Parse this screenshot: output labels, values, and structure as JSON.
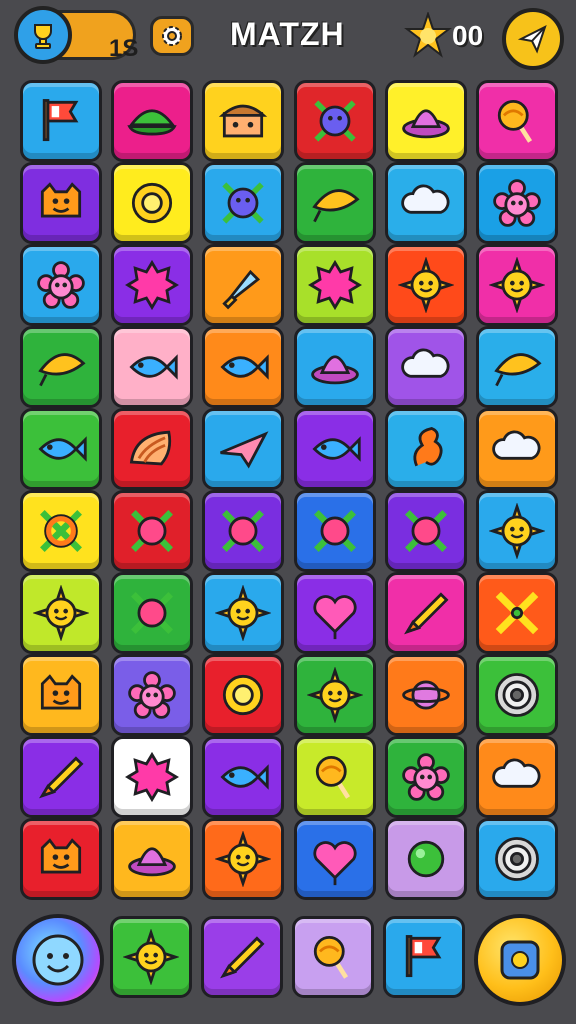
{
  "header": {
    "coin_count": "1S",
    "title": "MATZH",
    "star_count": "00",
    "icons": {
      "coin": "trophy-icon",
      "settings": "gear-icon",
      "star": "sun-star-icon",
      "send": "paper-plane-icon"
    }
  },
  "board": {
    "rows": [
      [
        {
          "color": "#2aa9ec",
          "icon": "flag"
        },
        {
          "color": "#ec1f8b",
          "icon": "cap"
        },
        {
          "color": "#ffd21e",
          "icon": "face"
        },
        {
          "color": "#e0262a",
          "icon": "blob-x"
        },
        {
          "color": "#fff02a",
          "icon": "hat"
        },
        {
          "color": "#f02fa8",
          "icon": "lollipop"
        }
      ],
      [
        {
          "color": "#7f2ee0",
          "icon": "monster"
        },
        {
          "color": "#ffec1e",
          "icon": "ring"
        },
        {
          "color": "#2aa9ec",
          "icon": "blob-x"
        },
        {
          "color": "#2fb33c",
          "icon": "leaf"
        },
        {
          "color": "#2aaeea",
          "icon": "cloud"
        },
        {
          "color": "#1aa0e6",
          "icon": "flower"
        }
      ],
      [
        {
          "color": "#2aa9ec",
          "icon": "flower"
        },
        {
          "color": "#8a2ee6",
          "icon": "splat"
        },
        {
          "color": "#ff9a1a",
          "icon": "rocket"
        },
        {
          "color": "#a8e02a",
          "icon": "splat"
        },
        {
          "color": "#ff4a1a",
          "icon": "sun"
        },
        {
          "color": "#f02fa8",
          "icon": "sun"
        }
      ],
      [
        {
          "color": "#2fb33c",
          "icon": "leaf"
        },
        {
          "color": "#ffb0c8",
          "icon": "fish"
        },
        {
          "color": "#ff8a1a",
          "icon": "fish"
        },
        {
          "color": "#2aa9ec",
          "icon": "hat"
        },
        {
          "color": "#a054e8",
          "icon": "cloud"
        },
        {
          "color": "#2aaeea",
          "icon": "leaf"
        }
      ],
      [
        {
          "color": "#3cc03a",
          "icon": "fish"
        },
        {
          "color": "#e8202c",
          "icon": "shell"
        },
        {
          "color": "#2aa9ec",
          "icon": "plane"
        },
        {
          "color": "#8a2ee6",
          "icon": "fish"
        },
        {
          "color": "#2aaeea",
          "icon": "seahorse"
        },
        {
          "color": "#ff9a1a",
          "icon": "cloud"
        }
      ],
      [
        {
          "color": "#ffe21e",
          "icon": "ring-x"
        },
        {
          "color": "#e0202a",
          "icon": "ball-x"
        },
        {
          "color": "#7a2ee0",
          "icon": "ball-x"
        },
        {
          "color": "#2a70e8",
          "icon": "ball-x"
        },
        {
          "color": "#7a2ee0",
          "icon": "ball-x"
        },
        {
          "color": "#2aa9ec",
          "icon": "sun"
        }
      ],
      [
        {
          "color": "#c0e82a",
          "icon": "sun"
        },
        {
          "color": "#2fb33c",
          "icon": "ball-x"
        },
        {
          "color": "#2aa9ec",
          "icon": "sun"
        },
        {
          "color": "#8a2ee6",
          "icon": "heart"
        },
        {
          "color": "#f02fa8",
          "icon": "crayon"
        },
        {
          "color": "#ff5a1a",
          "icon": "swords"
        }
      ],
      [
        {
          "color": "#ffb81e",
          "icon": "monster"
        },
        {
          "color": "#7a5ee8",
          "icon": "flower"
        },
        {
          "color": "#e8202c",
          "icon": "ring"
        },
        {
          "color": "#2fb33c",
          "icon": "sun"
        },
        {
          "color": "#ff7a1a",
          "icon": "planet"
        },
        {
          "color": "#3cc03a",
          "icon": "target"
        }
      ],
      [
        {
          "color": "#8a2ee6",
          "icon": "crayon"
        },
        {
          "color": "#ffffff",
          "icon": "splat"
        },
        {
          "color": "#8a2ee6",
          "icon": "fish"
        },
        {
          "color": "#c8ea2a",
          "icon": "lollipop"
        },
        {
          "color": "#2fb33c",
          "icon": "flower"
        },
        {
          "color": "#ff8a1a",
          "icon": "cloud"
        }
      ],
      [
        {
          "color": "#e8202c",
          "icon": "monster"
        },
        {
          "color": "#ffb81e",
          "icon": "hat"
        },
        {
          "color": "#ff6a1a",
          "icon": "sun"
        },
        {
          "color": "#2a70e8",
          "icon": "heart"
        },
        {
          "color": "#c89ae8",
          "icon": "ball"
        },
        {
          "color": "#2aa9ec",
          "icon": "target"
        }
      ]
    ]
  },
  "footer": {
    "tray": [
      {
        "color": "#3cc03a",
        "icon": "sun"
      },
      {
        "color": "#9a3ee8",
        "icon": "crayon"
      },
      {
        "color": "#c8a0f0",
        "icon": "lollipop"
      },
      {
        "color": "#2aa9ec",
        "icon": "flag"
      }
    ],
    "icons": {
      "avatar": "smiley-face-icon",
      "action": "square-target-icon"
    }
  }
}
